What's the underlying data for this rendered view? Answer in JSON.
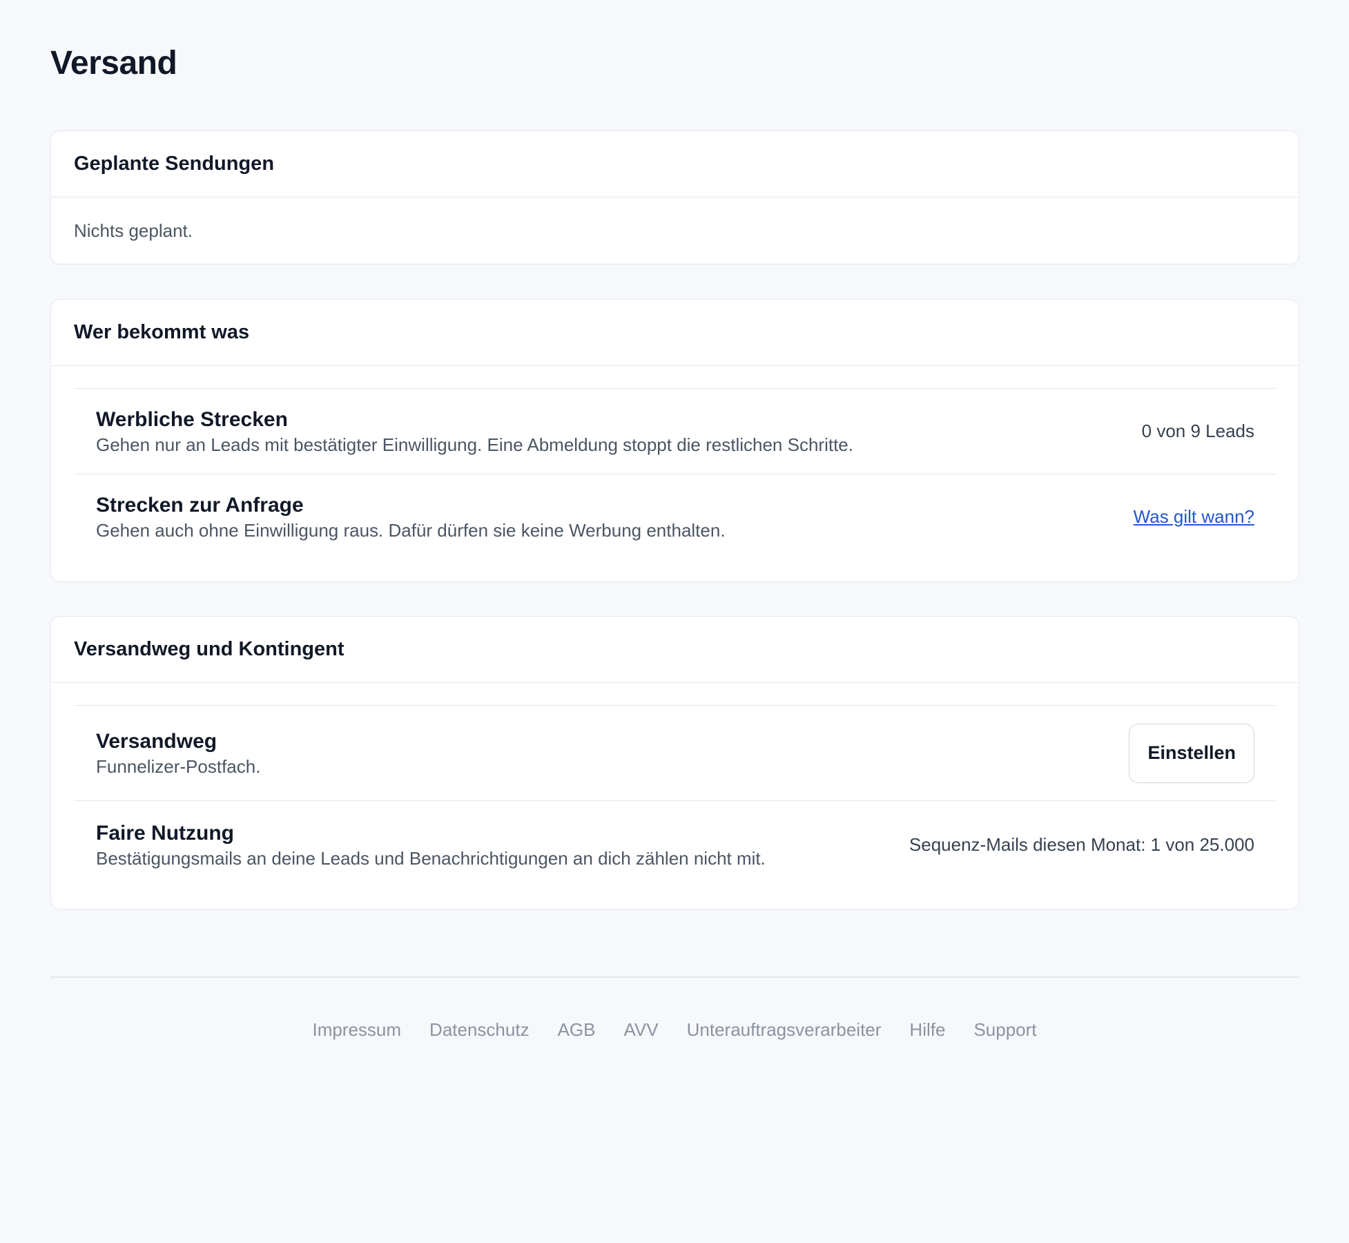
{
  "page": {
    "title": "Versand"
  },
  "scheduled": {
    "title": "Geplante Sendungen",
    "empty_text": "Nichts geplant."
  },
  "audience": {
    "title": "Wer bekommt was",
    "rows": [
      {
        "title": "Werbliche Strecken",
        "description": "Gehen nur an Leads mit bestätigter Einwilligung. Eine Abmeldung stoppt die restlichen Schritte.",
        "aside": "0 von 9 Leads"
      },
      {
        "title": "Strecken zur Anfrage",
        "description": "Gehen auch ohne Einwilligung raus. Dafür dürfen sie keine Werbung enthalten.",
        "link": "Was gilt wann?"
      }
    ]
  },
  "delivery": {
    "title": "Versandweg und Kontingent",
    "rows": [
      {
        "title": "Versandweg",
        "description": "Funnelizer-Postfach.",
        "button": "Einstellen"
      },
      {
        "title": "Faire Nutzung",
        "description": "Bestätigungsmails an deine Leads und Benachrichtigungen an dich zählen nicht mit.",
        "aside": "Sequenz-Mails diesen Monat: 1 von 25.000"
      }
    ]
  },
  "footer": {
    "links": [
      "Impressum",
      "Datenschutz",
      "AGB",
      "AVV",
      "Unterauftragsverarbeiter",
      "Hilfe",
      "Support"
    ]
  },
  "colors": {
    "background": "#f7f8fb",
    "card": "#ffffff",
    "border": "#e3e7ee",
    "link": "#2357c9",
    "footer_text": "#8b93a1"
  }
}
